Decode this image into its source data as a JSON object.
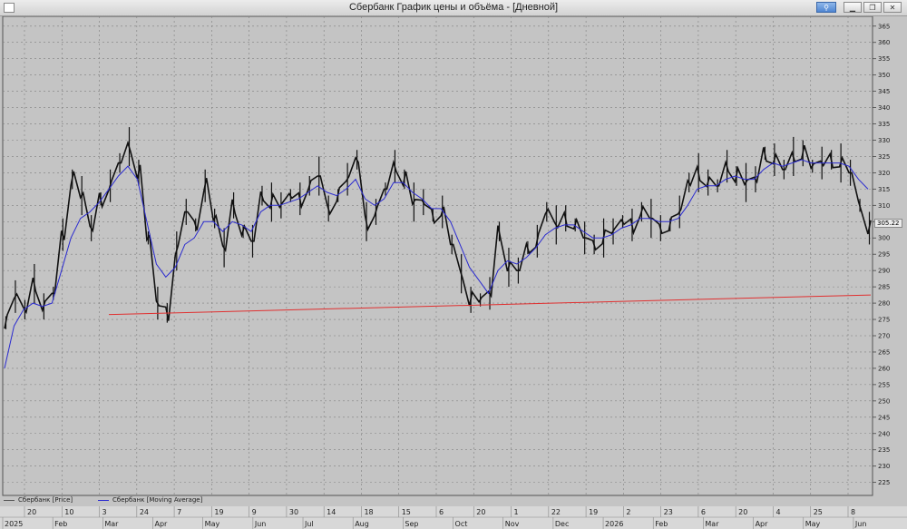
{
  "window": {
    "title": "Сбербанк График цены и объёма - [Дневной]",
    "buttons": [
      {
        "name": "pin-button",
        "icon": "pin-icon"
      },
      {
        "name": "minimize-button",
        "icon": "minimize-icon"
      },
      {
        "name": "restore-button",
        "icon": "restore-icon"
      },
      {
        "name": "close-button",
        "icon": "close-icon"
      }
    ]
  },
  "legend": [
    {
      "label": "Сбербанк [Price]",
      "color": "#555555"
    },
    {
      "label": "Сбербанк [Moving Average]",
      "color": "#2a2ad0"
    }
  ],
  "last_price_label": "305.22",
  "chart_data": {
    "type": "line",
    "y_ticks": [
      225,
      230,
      235,
      240,
      245,
      250,
      255,
      260,
      265,
      270,
      275,
      280,
      285,
      290,
      295,
      300,
      305,
      310,
      315,
      320,
      325,
      330,
      335,
      340,
      345,
      350,
      355,
      360,
      365
    ],
    "ylim": [
      221,
      368
    ],
    "x_day_ticks": [
      "20",
      "10",
      "3",
      "24",
      "7",
      "19",
      "9",
      "30",
      "14",
      "18",
      "15",
      "6",
      "20",
      "1",
      "22",
      "19",
      "2",
      "23",
      "6",
      "20",
      "4",
      "25",
      "8"
    ],
    "x_month_labels": [
      "2025",
      "Feb",
      "Mar",
      "Apr",
      "May",
      "Jun",
      "Jul",
      "Aug",
      "Sep",
      "Oct",
      "Nov",
      "Dec",
      "2026",
      "Feb",
      "Mar",
      "Apr",
      "May",
      "Jun"
    ],
    "grid": true,
    "colors": {
      "price": "#111111",
      "moving_average": "#2a2ad0",
      "trendline": "#e03030",
      "background": "#c4c4c4",
      "grid": "#7f7f7f"
    },
    "series": [
      {
        "name": "Сбербанк [Price]",
        "values": [
          274,
          282,
          278,
          286,
          279,
          283,
          301,
          318,
          313,
          303,
          312,
          316,
          323,
          328,
          320,
          300,
          280,
          277,
          296,
          308,
          304,
          316,
          306,
          297,
          310,
          302,
          299,
          313,
          311,
          310,
          313,
          312,
          316,
          319,
          309,
          313,
          318,
          324,
          305,
          308,
          315,
          322,
          318,
          311,
          311,
          307,
          308,
          298,
          289,
          281,
          281,
          283,
          302,
          291,
          290,
          297,
          299,
          308,
          304,
          306,
          304,
          300,
          298,
          300,
          302,
          305,
          304,
          308,
          306,
          303,
          304,
          308,
          317,
          320,
          317,
          316,
          322,
          319,
          317,
          318,
          326,
          324,
          321,
          325,
          326,
          322,
          323,
          324,
          323,
          320,
          310,
          303
        ]
      },
      {
        "name": "Сбербанк [Moving Average]",
        "values": [
          260,
          273,
          278,
          280,
          279,
          280,
          290,
          300,
          306,
          308,
          311,
          315,
          319,
          322,
          318,
          305,
          292,
          288,
          291,
          298,
          300,
          305,
          305,
          302,
          305,
          304,
          302,
          308,
          310,
          310,
          311,
          312,
          314,
          316,
          314,
          313,
          315,
          318,
          312,
          310,
          312,
          317,
          317,
          314,
          312,
          309,
          309,
          305,
          298,
          291,
          287,
          283,
          290,
          293,
          292,
          294,
          297,
          301,
          303,
          304,
          304,
          302,
          300,
          300,
          301,
          303,
          304,
          306,
          306,
          305,
          305,
          306,
          310,
          315,
          316,
          316,
          318,
          319,
          318,
          318,
          321,
          323,
          322,
          323,
          324,
          323,
          323,
          323,
          323,
          322,
          318,
          315
        ]
      },
      {
        "name": "trendline",
        "values": [
          276.5,
          282.5
        ]
      }
    ]
  }
}
